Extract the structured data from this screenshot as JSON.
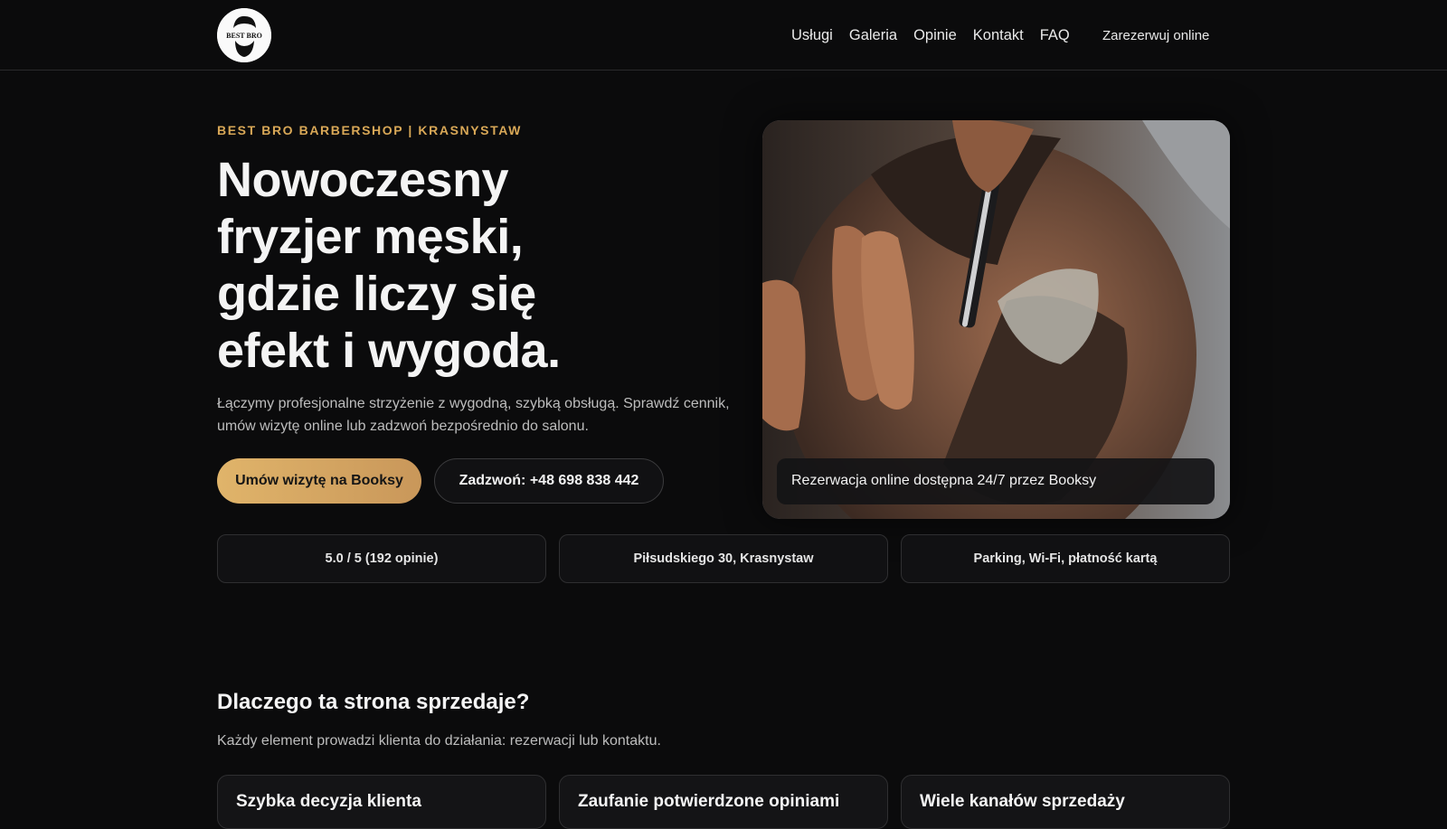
{
  "header": {
    "logo_text": "BEST BRO",
    "nav": [
      "Usługi",
      "Galeria",
      "Opinie",
      "Kontakt",
      "FAQ"
    ],
    "cta": "Zarezerwuj online"
  },
  "hero": {
    "eyebrow": "BEST BRO BARBERSHOP | KRASNYSTAW",
    "headline_lines": [
      "Nowoczesny",
      "fryzjer męski,",
      "gdzie liczy się",
      "efekt i wygoda."
    ],
    "lead": "Łączymy profesjonalne strzyżenie z wygodną, szybką obsługą. Sprawdź cennik, umów wizytę online lub zadzwoń bezpośrednio do salonu.",
    "primary_button": "Umów wizytę na Booksy",
    "secondary_button": "Zadzwoń: +48 698 838 442",
    "image_caption": "Rezerwacja online dostępna 24/7 przez Booksy",
    "image_icon": "barber-shaving-photo"
  },
  "stats": [
    "5.0 / 5 (192 opinie)",
    "Piłsudskiego 30, Krasnystaw",
    "Parking, Wi-Fi, płatność kartą"
  ],
  "why": {
    "title": "Dlaczego ta strona sprzedaje?",
    "subtitle": "Każdy element prowadzi klienta do działania: rezerwacji lub kontaktu.",
    "cards": [
      "Szybka decyzja klienta",
      "Zaufanie potwierdzone opiniami",
      "Wiele kanałów sprzedaży"
    ]
  },
  "colors": {
    "background": "#0b0b0c",
    "accent": "#d9a857",
    "button_gradient_start": "#e0b46a",
    "button_gradient_end": "#c9975a",
    "card_border": "#2f2f31"
  }
}
